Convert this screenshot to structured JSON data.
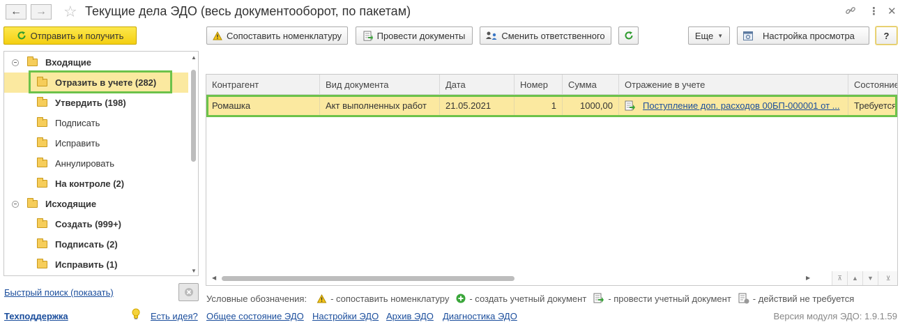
{
  "window": {
    "title": "Текущие дела ЭДО (весь документооборот, по пакетам)"
  },
  "toolbar": {
    "send_receive": "Отправить и получить",
    "match_nomenclature": "Сопоставить номенклатуру",
    "post_documents": "Провести документы",
    "change_responsible": "Сменить ответственного",
    "more": "Еще",
    "view_settings": "Настройка просмотра",
    "help": "?"
  },
  "tree": {
    "incoming": {
      "label": "Входящие",
      "items": [
        {
          "label": "Отразить в учете (282)",
          "bold": true,
          "selected": true
        },
        {
          "label": "Утвердить (198)",
          "bold": true
        },
        {
          "label": "Подписать",
          "bold": false
        },
        {
          "label": "Исправить",
          "bold": false
        },
        {
          "label": "Аннулировать",
          "bold": false
        },
        {
          "label": "На контроле (2)",
          "bold": true
        }
      ]
    },
    "outgoing": {
      "label": "Исходящие",
      "items": [
        {
          "label": "Создать (999+)",
          "bold": true
        },
        {
          "label": "Подписать (2)",
          "bold": true
        },
        {
          "label": "Исправить (1)",
          "bold": true
        }
      ]
    }
  },
  "quick_search": "Быстрый поиск (показать)",
  "table": {
    "columns": [
      "Контрагент",
      "Вид документа",
      "Дата",
      "Номер",
      "Сумма",
      "Отражение в учете",
      "Состояние"
    ],
    "rows": [
      {
        "counterparty": "Ромашка",
        "doc_type": "Акт выполненных работ",
        "date": "21.05.2021",
        "number": "1",
        "sum": "1000,00",
        "accounting": "Поступление доп. расходов 00БП-000001 от ...",
        "state": "Требуется"
      }
    ]
  },
  "legend": {
    "title": "Условные обозначения:",
    "items": [
      {
        "icon": "warning-icon",
        "label": "- сопоставить номенклатуру"
      },
      {
        "icon": "plus-circle-icon",
        "label": "- создать учетный документ"
      },
      {
        "icon": "post-document-icon",
        "label": "- провести учетный документ"
      },
      {
        "icon": "no-action-icon",
        "label": "- действий не требуется"
      }
    ]
  },
  "footer": {
    "support": "Техподдержка",
    "idea": "Есть идея?",
    "general_state": "Общее состояние ЭДО",
    "settings": "Настройки ЭДО",
    "archive": "Архив ЭДО",
    "diagnostics": "Диагностика ЭДО",
    "version": "Версия модуля ЭДО: 1.9.1.59"
  },
  "colors": {
    "accent_yellow": "#f4cf12",
    "selection": "#fbe9a0",
    "highlight_outline": "#6cc24a",
    "link": "#1a4d9c"
  }
}
